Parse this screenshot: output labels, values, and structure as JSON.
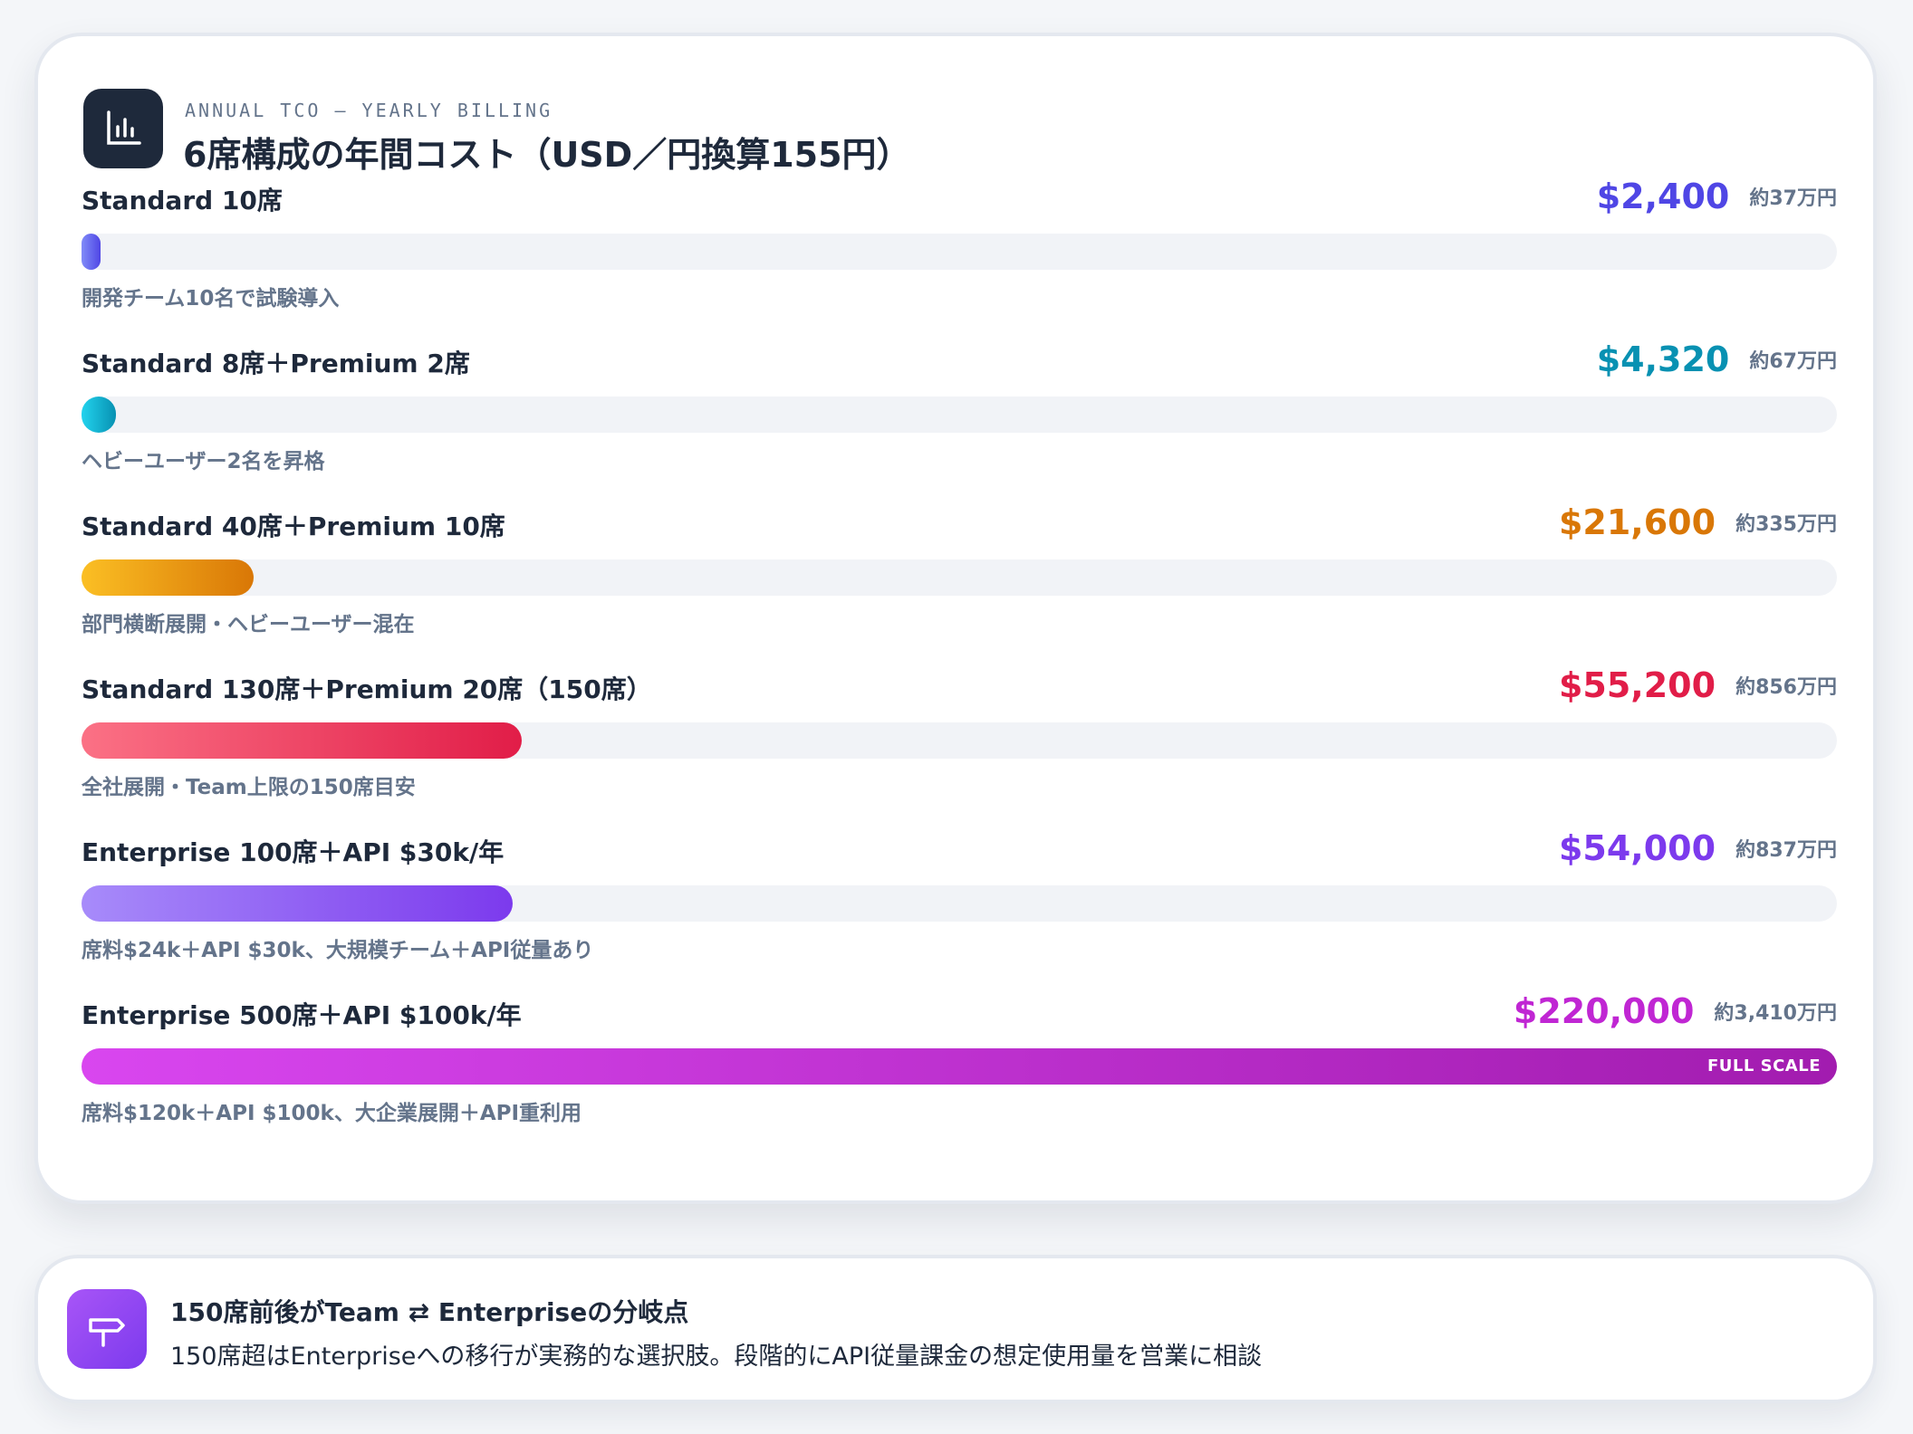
{
  "header": {
    "eyebrow": "ANNUAL TCO — YEARLY BILLING",
    "title": "6席構成の年間コスト（USD／円換算155円）"
  },
  "chart_data": {
    "type": "bar",
    "orientation": "horizontal",
    "xlim": [
      0,
      220000
    ],
    "unit": "USD",
    "categories": [
      "Standard 10席",
      "Standard 8席＋Premium 2席",
      "Standard 40席＋Premium 10席",
      "Standard 130席＋Premium 20席（150席）",
      "Enterprise 100席＋API $30k/年",
      "Enterprise 500席＋API $100k/年"
    ],
    "values": [
      2400,
      4320,
      21600,
      55200,
      54000,
      220000
    ],
    "value_labels": [
      "$2,400",
      "$4,320",
      "$21,600",
      "$55,200",
      "$54,000",
      "$220,000"
    ],
    "yen_labels": [
      "約37万円",
      "約67万円",
      "約335万円",
      "約856万円",
      "約837万円",
      "約3,410万円"
    ],
    "notes": [
      "開発チーム10名で試験導入",
      "ヘビーユーザー2名を昇格",
      "部門横断展開・ヘビーユーザー混在",
      "全社展開・Team上限の150席目安",
      "席料$24k＋API $30k、大規模チーム＋API従量あり",
      "席料$120k＋API $100k、大企業展開＋API重利用"
    ],
    "colors": [
      "#4f46e5",
      "#0891b2",
      "#d97706",
      "#e11d48",
      "#7c3aed",
      "#c026d3"
    ],
    "gradients": [
      [
        "#818cf8",
        "#4f46e5"
      ],
      [
        "#22d3ee",
        "#0891b2"
      ],
      [
        "#fbbf24",
        "#d97706"
      ],
      [
        "#fb7185",
        "#e11d48"
      ],
      [
        "#a78bfa",
        "#7c3aed"
      ],
      [
        "#d946ef",
        "#a21caf"
      ]
    ],
    "badge": "FULL SCALE"
  },
  "callout": {
    "icon": "signpost-icon",
    "title": "150席前後がTeam ⇄ Enterpriseの分岐点",
    "body": "150席超はEnterpriseへの移行が実務的な選択肢。段階的にAPI従量課金の想定使用量を営業に相談"
  }
}
